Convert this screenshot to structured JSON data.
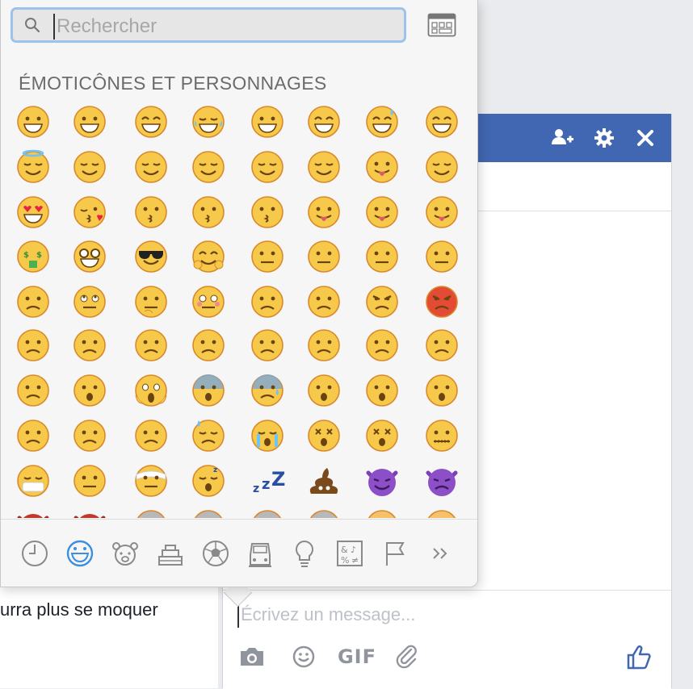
{
  "picker": {
    "search_placeholder": "Rechercher",
    "section_title": "ÉMOTICÔNES ET PERSONNAGES",
    "emoji_rows": [
      [
        "grinning",
        "grimacing",
        "grin",
        "joy",
        "smiley",
        "smile",
        "sweat-smile",
        "laughing"
      ],
      [
        "innocent",
        "wink",
        "blush",
        "slight-smile",
        "upside-down",
        "relaxed",
        "yum",
        "relieved"
      ],
      [
        "heart-eyes",
        "kissing-heart",
        "kissing",
        "kissing-smiling-eyes",
        "kissing-closed-eyes",
        "stuck-out-tongue-winking",
        "stuck-out-tongue-closed-eyes",
        "stuck-out-tongue"
      ],
      [
        "money-mouth",
        "nerd",
        "sunglasses",
        "hugging",
        "smirk",
        "no-mouth",
        "neutral",
        "expressionless"
      ],
      [
        "unamused",
        "rolling-eyes",
        "thinking",
        "flushed",
        "disappointed",
        "worried",
        "angry",
        "rage"
      ],
      [
        "pensive",
        "confused",
        "slight-frown",
        "frowning",
        "persevere",
        "confounded",
        "tired",
        "weary"
      ],
      [
        "triumph",
        "open-mouth",
        "scream",
        "fearful",
        "cold-sweat",
        "hushed",
        "frowning-open",
        "anguished"
      ],
      [
        "cry",
        "disappointed-relieved",
        "sleepy",
        "sweat",
        "sob",
        "dizzy",
        "astonished",
        "zipper-mouth"
      ],
      [
        "mask",
        "thermometer-face",
        "head-bandage",
        "sleeping",
        "zzz",
        "poop",
        "smiling-imp",
        "imp"
      ]
    ],
    "categories": [
      "recent",
      "smileys",
      "animals",
      "food",
      "sports",
      "travel",
      "objects",
      "symbols",
      "flags",
      "more"
    ],
    "active_category": "smileys"
  },
  "chat": {
    "header_icons": [
      "add-friend",
      "settings",
      "close"
    ],
    "message_placeholder": "Écrivez un message...",
    "compose_gif_label": "GIF",
    "partial_text": "urra plus se moquer"
  },
  "colors": {
    "facebook_blue": "#4267b2",
    "emoji_yellow": "#f7c94a",
    "search_focus": "#9ec2eb",
    "active_icon": "#3b8ee0"
  }
}
